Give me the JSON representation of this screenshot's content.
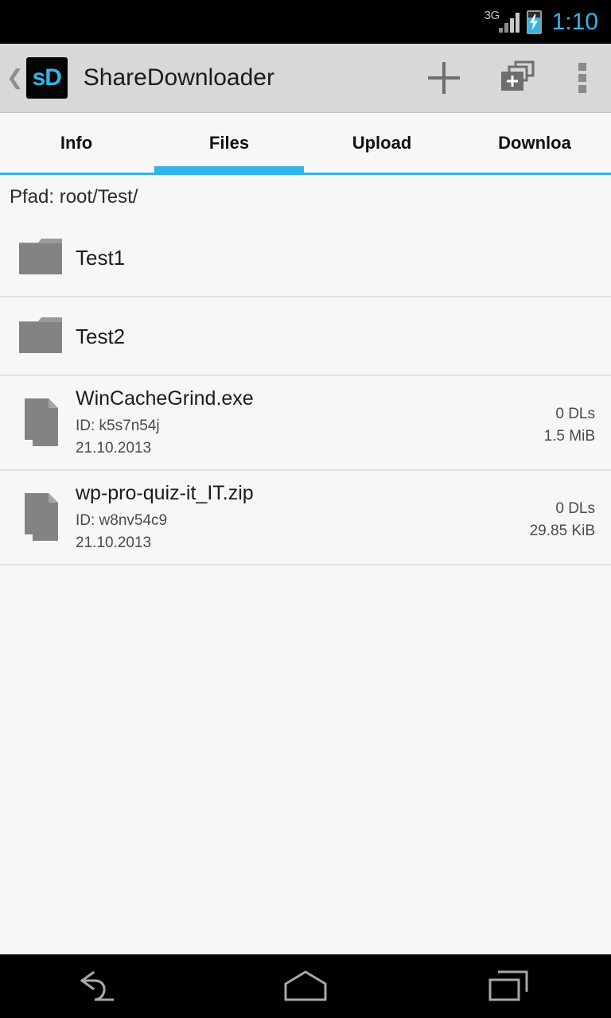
{
  "status_bar": {
    "network_label": "3G",
    "signal_icon": "signal-bars-icon",
    "battery_icon": "battery-charging-icon",
    "clock": "1:10",
    "clock_color": "#33b5e5"
  },
  "action_bar": {
    "up_icon": "chevron-left-icon",
    "app_logo_text": "sD",
    "app_logo_color": "#33b5e5",
    "title": "ShareDownloader",
    "actions": [
      {
        "name": "add-button",
        "icon": "plus-icon"
      },
      {
        "name": "new-folder-button",
        "icon": "new-folder-icon"
      },
      {
        "name": "overflow-menu-button",
        "icon": "overflow-dots-icon"
      }
    ]
  },
  "tabs": {
    "accent_color": "#33b5e5",
    "items": [
      {
        "label": "Info",
        "active": false
      },
      {
        "label": "Files",
        "active": true
      },
      {
        "label": "Upload",
        "active": false
      },
      {
        "label": "Downloa",
        "active": false
      }
    ]
  },
  "path": {
    "label": "Pfad:",
    "value": "root/Test/",
    "full": "Pfad: root/Test/"
  },
  "list": {
    "folders": [
      {
        "name": "Test1",
        "icon": "folder-icon"
      },
      {
        "name": "Test2",
        "icon": "folder-icon"
      }
    ],
    "files": [
      {
        "name": "WinCacheGrind.exe",
        "id_line": "ID: k5s7n54j",
        "date": "21.10.2013",
        "downloads": "0 DLs",
        "size": "1.5 MiB",
        "icon": "file-icon"
      },
      {
        "name": "wp-pro-quiz-it_IT.zip",
        "id_line": "ID: w8nv54c9",
        "date": "21.10.2013",
        "downloads": "0 DLs",
        "size": "29.85 KiB",
        "icon": "file-icon"
      }
    ]
  },
  "nav_bar": {
    "buttons": [
      {
        "name": "nav-back-button",
        "icon": "back-arrow-icon"
      },
      {
        "name": "nav-home-button",
        "icon": "home-icon"
      },
      {
        "name": "nav-recents-button",
        "icon": "recents-icon"
      }
    ]
  }
}
